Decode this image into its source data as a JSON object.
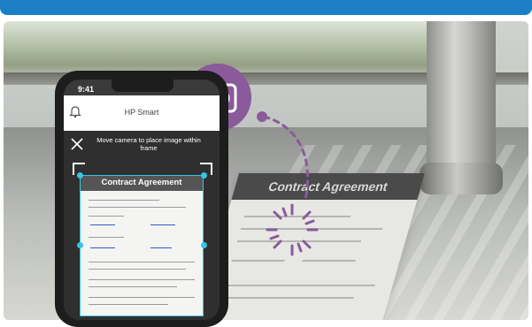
{
  "app": {
    "status_time": "9:41",
    "title": "HP Smart",
    "instruction": "Move camera to place image within frame"
  },
  "document": {
    "title": "Contract Agreement"
  },
  "icons": {
    "close": "close-icon",
    "bell": "bell-icon",
    "camera": "camera-icon"
  },
  "colors": {
    "brand_blue": "#1a7fc4",
    "crop_cyan": "#35c6e5",
    "badge_purple": "#8b5a9a"
  }
}
